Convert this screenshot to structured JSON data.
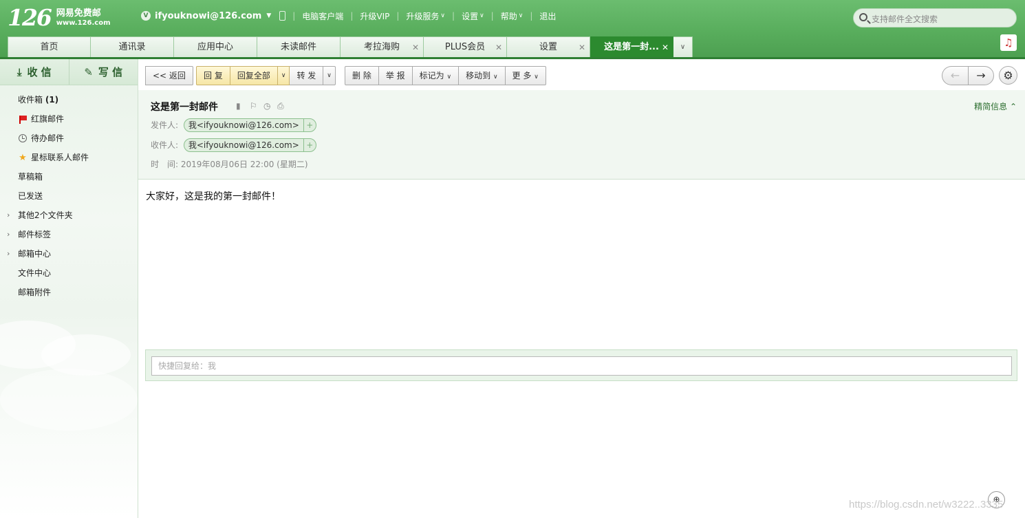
{
  "header": {
    "logo_num": "126",
    "logo_line1": "网易免费邮",
    "logo_line2": "www.126.com",
    "vip_badge": "V",
    "account": "ifyouknowi@126.com",
    "nav": [
      "电脑客户端",
      "升级VIP",
      "升级服务",
      "设置",
      "帮助",
      "退出"
    ],
    "search_placeholder": "支持邮件全文搜索"
  },
  "tabs": [
    {
      "label": "首页"
    },
    {
      "label": "通讯录"
    },
    {
      "label": "应用中心"
    },
    {
      "label": "未读邮件"
    },
    {
      "label": "考拉海购",
      "closable": true
    },
    {
      "label": "PLUS会员",
      "closable": true
    },
    {
      "label": "设置",
      "closable": true
    },
    {
      "label": "这是第一封...",
      "closable": true,
      "active": true
    }
  ],
  "sidebar": {
    "receive": "收 信",
    "compose": "写 信",
    "folders": [
      {
        "label": "收件箱",
        "count": "(1)"
      },
      {
        "label": "红旗邮件",
        "icon": "red-flag-icon"
      },
      {
        "label": "待办邮件",
        "icon": "clock-icon"
      },
      {
        "label": "星标联系人邮件",
        "icon": "star-icon"
      },
      {
        "label": "草稿箱"
      },
      {
        "label": "已发送"
      },
      {
        "label": "其他2个文件夹",
        "expandable": true
      },
      {
        "label": "邮件标签",
        "expandable": true
      },
      {
        "label": "邮箱中心",
        "expandable": true
      },
      {
        "label": "文件中心"
      },
      {
        "label": "邮箱附件"
      }
    ]
  },
  "toolbar": {
    "back": "<< 返回",
    "reply": "回 复",
    "reply_all": "回复全部",
    "forward": "转 发",
    "delete": "删 除",
    "report": "举 报",
    "mark_as": "标记为",
    "move_to": "移动到",
    "more": "更 多"
  },
  "mail": {
    "subject": "这是第一封邮件",
    "simple_info": "精简信息",
    "from_label": "发件人:",
    "from": "我<ifyouknowi@126.com>",
    "to_label": "收件人:",
    "to": "我<ifyouknowi@126.com>",
    "time_label": "时　间:",
    "time": "2019年08月06日 22:00 (星期二)",
    "body": "大家好，这是我的第一封邮件！"
  },
  "quick_reply": {
    "placeholder": "快捷回复给：我"
  },
  "watermark": "https://blog.csdn.net/w3222..3335"
}
